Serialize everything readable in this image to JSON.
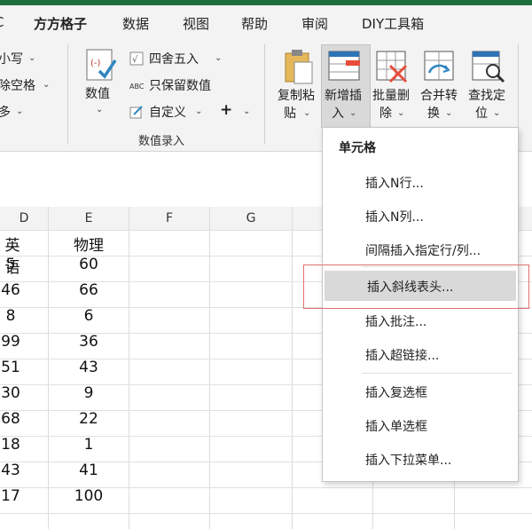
{
  "tabs": [
    {
      "label": "C"
    },
    {
      "label": "方方格子",
      "active": true
    },
    {
      "label": "数据"
    },
    {
      "label": "视图"
    },
    {
      "label": "帮助"
    },
    {
      "label": "审阅"
    },
    {
      "label": "DIY工具箱"
    }
  ],
  "ribbon": {
    "left_items": [
      "小写",
      "除空格",
      "多"
    ],
    "numvalue_label": "数值",
    "round_label": "四舍五入",
    "keep_label": "只保留数值",
    "custom_label": "自定义",
    "plus_label": "+",
    "group_label": "数值录入",
    "copy_paste_label_1": "复制粘",
    "copy_paste_label_2": "贴",
    "new_insert_label_1": "新增插",
    "new_insert_label_2": "入",
    "batch_delete_label_1": "批量删",
    "batch_delete_label_2": "除",
    "merge_convert_label_1": "合并转",
    "merge_convert_label_2": "换",
    "find_locate_label_1": "查找定",
    "find_locate_label_2": "位",
    "round_icon_text": "√",
    "keep_icon_text": "ABC"
  },
  "sheet": {
    "columns": [
      "D",
      "E",
      "F",
      "G"
    ],
    "header_row": [
      "英语",
      "物理"
    ],
    "rows": [
      [
        "5",
        "60"
      ],
      [
        "46",
        "66"
      ],
      [
        "8",
        "6"
      ],
      [
        "99",
        "36"
      ],
      [
        "51",
        "43"
      ],
      [
        "30",
        "9"
      ],
      [
        "68",
        "22"
      ],
      [
        "18",
        "1"
      ],
      [
        "43",
        "41"
      ],
      [
        "17",
        "100"
      ]
    ]
  },
  "menu": {
    "title": "单元格",
    "items": [
      "插入N行...",
      "插入N列...",
      "间隔插入指定行/列...",
      "插入斜线表头...",
      "插入批注...",
      "插入超链接...",
      "插入复选框",
      "插入单选框",
      "插入下拉菜单..."
    ],
    "highlighted_index": 3
  },
  "colors": {
    "accent": "#1f6f3c",
    "ribbon_bg": "#f3f3f3",
    "highlight": "#d9d9d9",
    "annotation": "#e07070"
  }
}
